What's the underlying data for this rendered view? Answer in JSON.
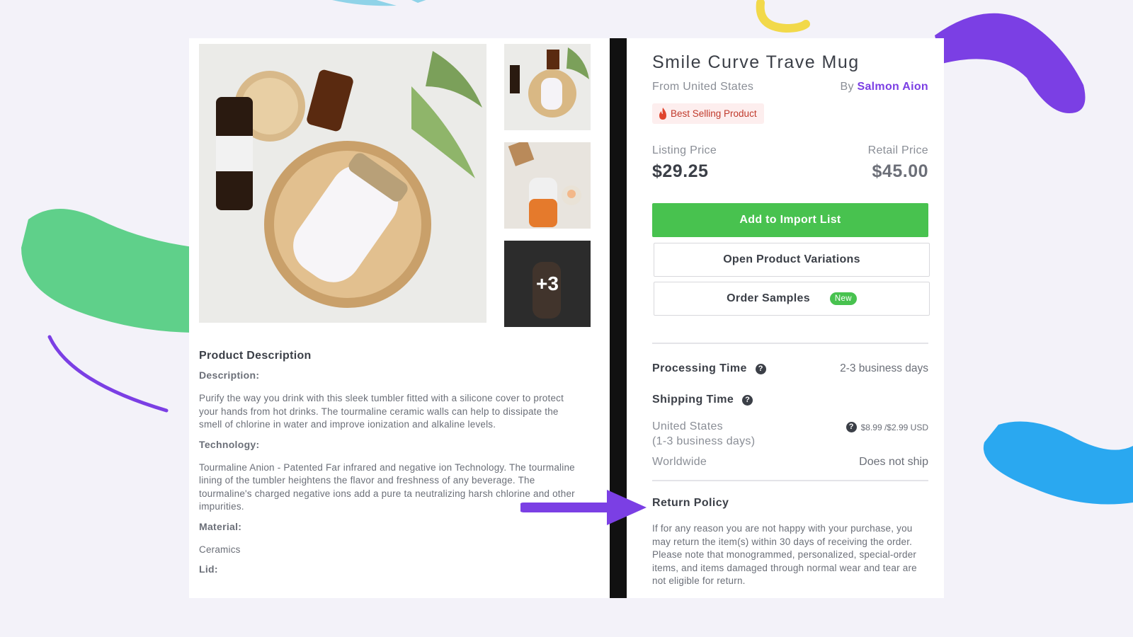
{
  "gallery": {
    "more_count": "+3"
  },
  "description": {
    "heading": "Product Description",
    "description_label": "Description:",
    "description_text": "Purify the way you drink with this sleek tumbler fitted with a silicone cover to protect your hands from hot drinks. The tourmaline ceramic walls can help to dissipate the smell of chlorine in water and improve ionization and alkaline levels.",
    "technology_label": "Technology:",
    "technology_text": "Tourmaline Anion - Patented Far infrared and negative ion Technology. The tourmaline lining of the tumbler heightens the flavor and freshness of any beverage. The tourmaline's charged negative ions add a pure ta neutralizing harsh chlorine and other impurities.",
    "material_label": "Material:",
    "material_text": "Ceramics",
    "lid_label": "Lid:"
  },
  "product": {
    "title": "Smile Curve Trave Mug",
    "origin": "From United States",
    "by_label": "By",
    "seller": "Salmon Aion",
    "badge": "Best Selling Product"
  },
  "pricing": {
    "listing_label": "Listing Price",
    "listing_price": "$29.25",
    "retail_label": "Retail Price",
    "retail_price": "$45.00"
  },
  "actions": {
    "add_to_import": "Add to Import List",
    "open_variations": "Open Product Variations",
    "order_samples": "Order Samples",
    "new_badge": "New"
  },
  "shipping": {
    "processing_label": "Processing Time",
    "processing_value": "2-3 business days",
    "shipping_label": "Shipping Time",
    "us_dest": "United States",
    "us_days": "(1-3 business days)",
    "us_cost": "$8.99 /$2.99 USD",
    "ww_dest": "Worldwide",
    "ww_value": "Does not ship"
  },
  "return_policy": {
    "title": "Return Policy",
    "text": "If for any reason you are not happy with your purchase, you may return the item(s) within 30 days of receiving the order. Please note that monogrammed, personalized, special-order items, and items damaged through normal wear and tear are not eligible for return."
  },
  "colors": {
    "accent_purple": "#7b3fe4",
    "primary_green": "#48c24f",
    "blob_green": "#5fd08a",
    "blob_blue": "#2aa8f0",
    "blob_yellow": "#f2d94a"
  }
}
